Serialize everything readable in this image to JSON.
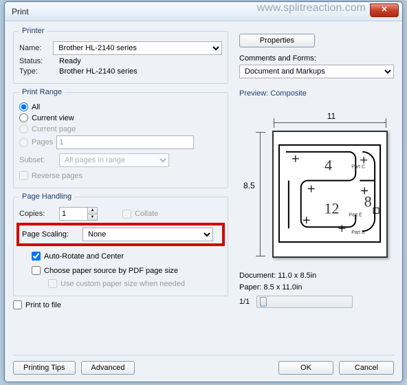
{
  "watermark": "www.splitreaction.com",
  "window": {
    "title": "Print"
  },
  "printer": {
    "legend": "Printer",
    "name_label": "Name:",
    "name_value": "Brother HL-2140 series",
    "status_label": "Status:",
    "status_value": "Ready",
    "type_label": "Type:",
    "type_value": "Brother HL-2140 series",
    "properties_btn": "Properties"
  },
  "comments": {
    "label": "Comments and Forms:",
    "value": "Document and Markups"
  },
  "range": {
    "legend": "Print Range",
    "all": "All",
    "current_view": "Current view",
    "current_page": "Current page",
    "pages": "Pages",
    "pages_value": "1",
    "subset_label": "Subset:",
    "subset_value": "All pages in range",
    "reverse": "Reverse pages"
  },
  "handling": {
    "legend": "Page Handling",
    "copies_label": "Copies:",
    "copies_value": "1",
    "collate": "Collate",
    "scaling_label": "Page Scaling:",
    "scaling_value": "None",
    "auto_rotate": "Auto-Rotate and Center",
    "paper_source": "Choose paper source by PDF page size",
    "custom_paper": "Use custom paper size when needed"
  },
  "print_to_file": "Print to file",
  "preview": {
    "title": "Preview: Composite",
    "width": "11",
    "height": "8.5",
    "doc_line": "Document: 11.0 x 8.5in",
    "paper_line": "Paper: 8.5 x 11.0in",
    "zoom": "1/1"
  },
  "footer": {
    "tips": "Printing Tips",
    "advanced": "Advanced",
    "ok": "OK",
    "cancel": "Cancel"
  }
}
